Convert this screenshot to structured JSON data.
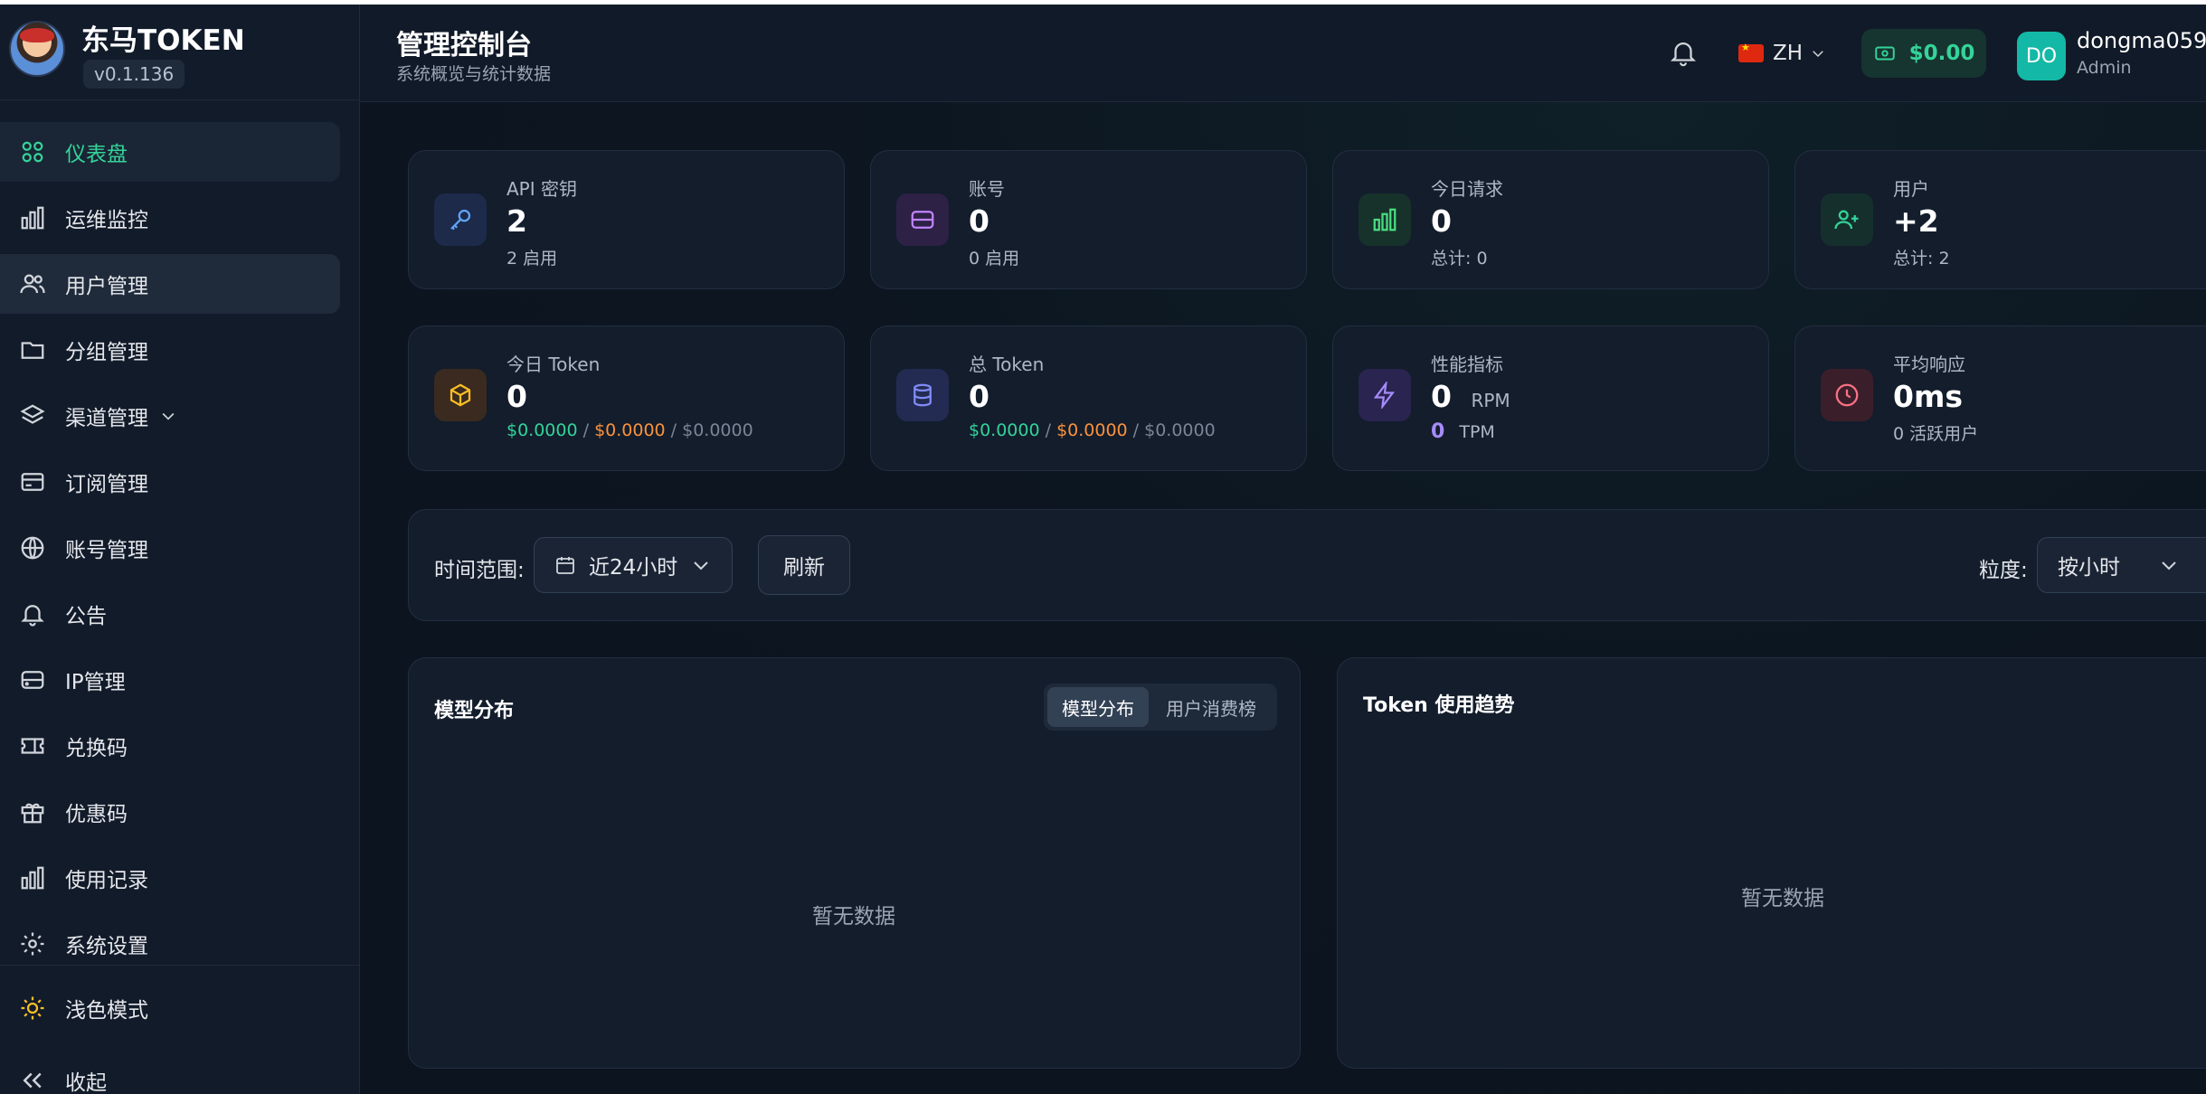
{
  "brand": {
    "name": "东马TOKEN",
    "version": "v0.1.136"
  },
  "sidebar": {
    "items": [
      {
        "label": "仪表盘",
        "icon": "dashboard-icon"
      },
      {
        "label": "运维监控",
        "icon": "bar-chart-icon"
      },
      {
        "label": "用户管理",
        "icon": "users-icon"
      },
      {
        "label": "分组管理",
        "icon": "folder-icon"
      },
      {
        "label": "渠道管理",
        "icon": "layers-icon"
      },
      {
        "label": "订阅管理",
        "icon": "credit-card-icon"
      },
      {
        "label": "账号管理",
        "icon": "globe-icon"
      },
      {
        "label": "公告",
        "icon": "bell-icon"
      },
      {
        "label": "IP管理",
        "icon": "server-icon"
      },
      {
        "label": "兑换码",
        "icon": "ticket-icon"
      },
      {
        "label": "优惠码",
        "icon": "gift-icon"
      },
      {
        "label": "使用记录",
        "icon": "bar-chart-icon"
      },
      {
        "label": "系统设置",
        "icon": "gear-icon"
      }
    ],
    "theme_toggle": "浅色模式",
    "collapse": "收起"
  },
  "header": {
    "title": "管理控制台",
    "subtitle": "系统概览与统计数据",
    "language": "ZH",
    "balance": "$0.00",
    "avatar_initials": "DO",
    "username": "dongma059",
    "role": "Admin"
  },
  "stats": {
    "api_keys": {
      "label": "API 密钥",
      "value": "2",
      "sub": "2 启用"
    },
    "accounts": {
      "label": "账号",
      "value": "0",
      "sub": "0 启用"
    },
    "today_requests": {
      "label": "今日请求",
      "value": "0",
      "sub": "总计: 0"
    },
    "users": {
      "label": "用户",
      "value": "+2",
      "sub": "总计: 2"
    },
    "today_token": {
      "label": "今日 Token",
      "value": "0",
      "cost1": "$0.0000",
      "sep1": " / ",
      "cost2": "$0.0000",
      "sep2": " / ",
      "cost3": "$0.0000"
    },
    "total_token": {
      "label": "总 Token",
      "value": "0",
      "cost1": "$0.0000",
      "sep1": " / ",
      "cost2": "$0.0000",
      "sep2": " / ",
      "cost3": "$0.0000"
    },
    "performance": {
      "label": "性能指标",
      "rpm_value": "0",
      "rpm_unit": "RPM",
      "tpm_value": "0",
      "tpm_unit": "TPM"
    },
    "avg_response": {
      "label": "平均响应",
      "value": "0ms",
      "sub": "0 活跃用户"
    }
  },
  "filters": {
    "time_range_label": "时间范围:",
    "time_range_value": "近24小时",
    "refresh": "刷新",
    "granularity_label": "粒度:",
    "granularity_value": "按小时"
  },
  "panels": {
    "model_distribution": {
      "title": "模型分布",
      "tabs": [
        "模型分布",
        "用户消费榜"
      ],
      "empty": "暂无数据"
    },
    "token_trend": {
      "title": "Token 使用趋势",
      "empty": "暂无数据"
    }
  },
  "colors": {
    "accent": "#34d399",
    "orange": "#fb923c",
    "purple": "#a78bfa",
    "background": "#0d1420"
  }
}
